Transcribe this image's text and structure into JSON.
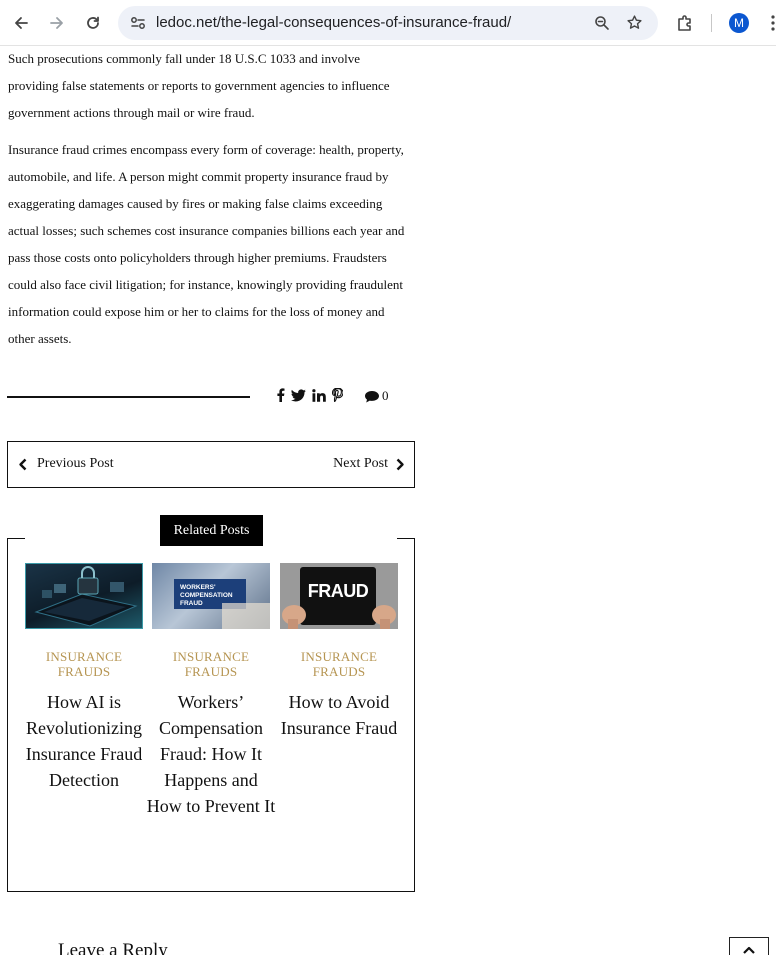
{
  "browser": {
    "url": "ledoc.net/the-legal-consequences-of-insurance-fraud/",
    "profile_initial": "M"
  },
  "article": {
    "paragraph1": "Such prosecutions commonly fall under 18 U.S.C 1033 and involve providing false statements or reports to government agencies to influence government actions through mail or wire fraud.",
    "paragraph2": "Insurance fraud crimes encompass every form of coverage: health, property, automobile, and life. A person might commit property insurance fraud by exaggerating damages caused by fires or making false claims exceeding actual losses; such schemes cost insurance companies billions each year and pass those costs onto policyholders through higher premiums. Fraudsters could also face civil litigation; for instance, knowingly providing fraudulent information could expose him or her to claims for the loss of money and other assets."
  },
  "share": {
    "icons": [
      "facebook-icon",
      "twitter-icon",
      "linkedin-icon",
      "pinterest-icon"
    ],
    "comment_count": "0"
  },
  "post_nav": {
    "previous_label": "Previous Post",
    "next_label": "Next Post"
  },
  "related": {
    "heading": "Related Posts",
    "posts": [
      {
        "category": "INSURANCE FRAUDS",
        "title": "How AI is Revolutionizing Insurance Fraud Detection"
      },
      {
        "category": "INSURANCE FRAUDS",
        "title": "Workers’ Compensation Fraud: How It Happens and How to Prevent It",
        "thumb_text": "WORKERS' COMPENSATION FRAUD"
      },
      {
        "category": "INSURANCE FRAUDS",
        "title": "How to Avoid Insurance Fraud",
        "thumb_text": "FRAUD"
      }
    ]
  },
  "comments": {
    "heading": "Leave a Reply"
  },
  "colors": {
    "category": "#b69552",
    "accent_dark": "#000000"
  }
}
